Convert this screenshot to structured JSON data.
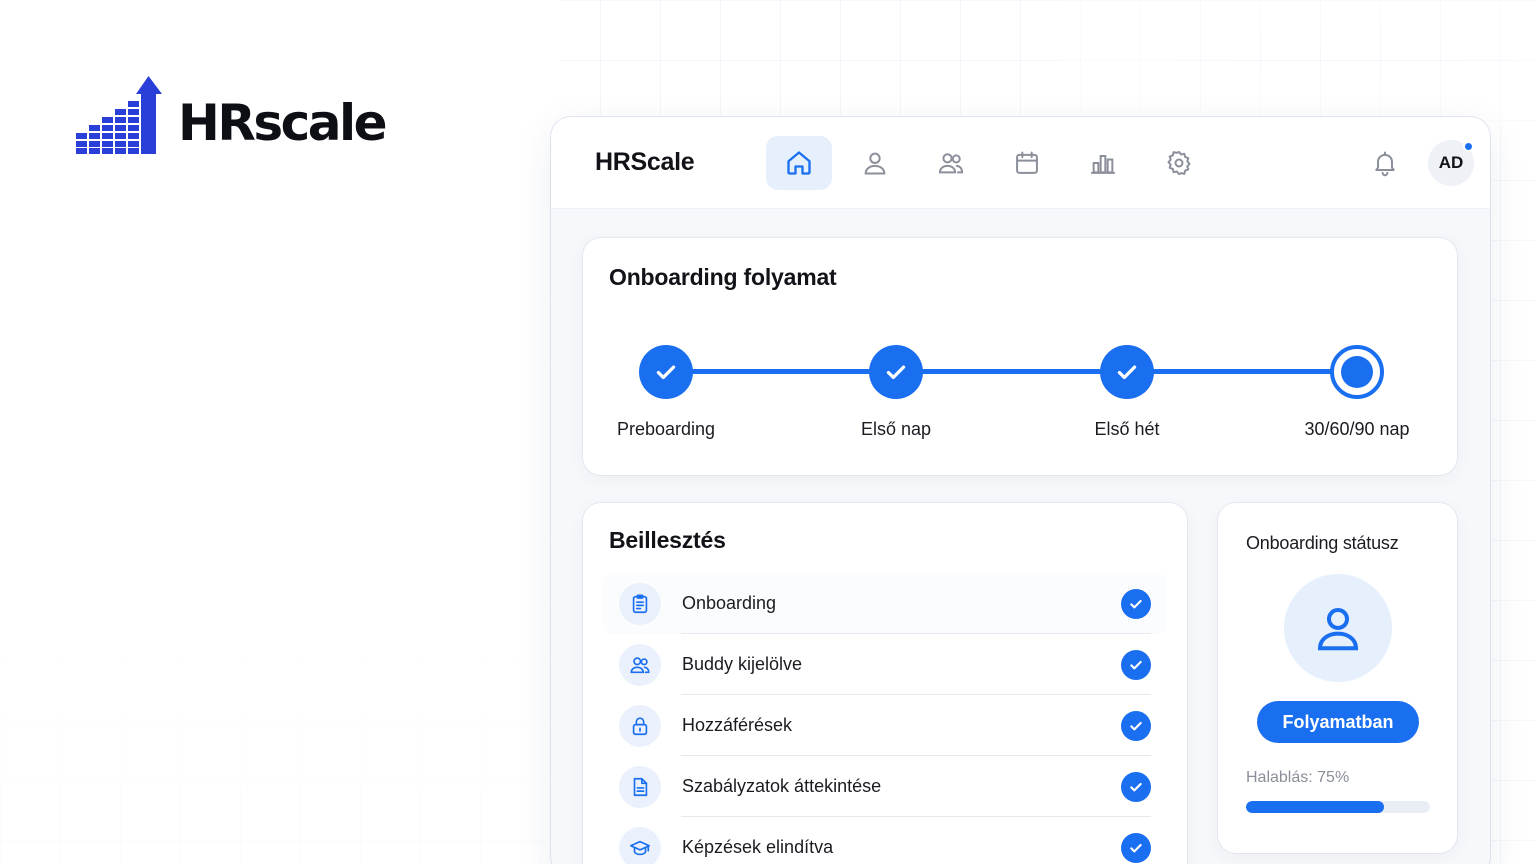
{
  "brand": {
    "wordmark": "HRscale",
    "color": "#2a3fd8"
  },
  "app": {
    "title": "HRScale",
    "nav": [
      {
        "name": "home-icon",
        "active": true
      },
      {
        "name": "user-icon",
        "active": false
      },
      {
        "name": "users-icon",
        "active": false
      },
      {
        "name": "calendar-icon",
        "active": false
      },
      {
        "name": "bar-chart-icon",
        "active": false
      },
      {
        "name": "gear-icon",
        "active": false
      }
    ],
    "notifications_icon": "bell-icon",
    "avatar_initials": "AD",
    "accent": "#1a6ff0"
  },
  "process": {
    "title": "Onboarding folyamat",
    "steps": [
      {
        "label": "Preboarding",
        "state": "done"
      },
      {
        "label": "Első nap",
        "state": "done"
      },
      {
        "label": "Első hét",
        "state": "done"
      },
      {
        "label": "30/60/90 nap",
        "state": "current"
      }
    ]
  },
  "insert": {
    "title": "Beillesztés",
    "items": [
      {
        "label": "Onboarding",
        "icon": "clipboard-icon",
        "done": true
      },
      {
        "label": "Buddy kijelölve",
        "icon": "users-icon",
        "done": true
      },
      {
        "label": "Hozzáférések",
        "icon": "lock-icon",
        "done": true
      },
      {
        "label": "Szabályzatok áttekintése",
        "icon": "document-icon",
        "done": true
      },
      {
        "label": "Képzések elindítva",
        "icon": "graduation-cap-icon",
        "done": true
      }
    ]
  },
  "status": {
    "title": "Onboarding státusz",
    "badge": "Folyamatban",
    "progress_label": "Halablás: 75%",
    "progress_value": 0.75
  }
}
